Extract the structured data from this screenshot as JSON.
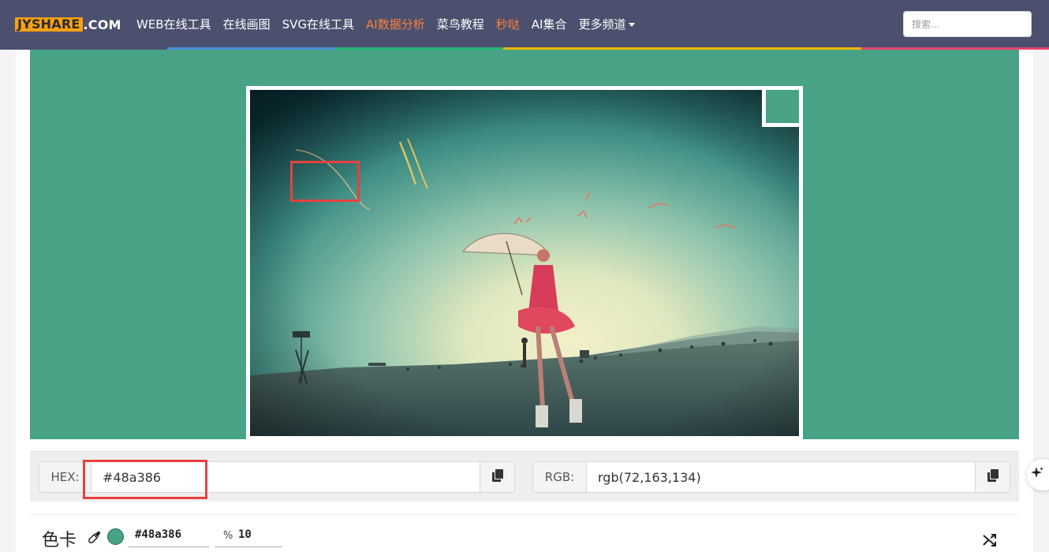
{
  "nav": {
    "logo_box": "JYSHARE",
    "logo_suffix": ".COM",
    "items": [
      {
        "label": "WEB在线工具",
        "highlight": false
      },
      {
        "label": "在线画图",
        "highlight": false
      },
      {
        "label": "SVG在线工具",
        "highlight": false
      },
      {
        "label": "AI数据分析",
        "highlight": true
      },
      {
        "label": "菜鸟教程",
        "highlight": false
      },
      {
        "label": "秒哒",
        "highlight": true
      },
      {
        "label": "AI集合",
        "highlight": false
      },
      {
        "label": "更多频道",
        "highlight": false,
        "dropdown": true
      }
    ],
    "search_placeholder": "搜索..."
  },
  "colors": {
    "navbar": "#4b506e",
    "picked": "#48a386",
    "accent_orange": "#ff7f3e",
    "highlight_red": "#e8413d",
    "stripe": [
      "#4a90d9",
      "#2bb673",
      "#f5b800",
      "#e8436b"
    ]
  },
  "picker": {
    "hex_label": "HEX:",
    "hex_value": "#48a386",
    "rgb_label": "RGB:",
    "rgb_value": "rgb(72,163,134)"
  },
  "color_card": {
    "title": "色卡",
    "hex_value": "#48a386",
    "step_value": "10",
    "percent_symbol": "%"
  },
  "icons": {
    "copy": "copy-icon",
    "eyedropper": "eyedropper-icon",
    "shuffle": "shuffle-icon",
    "sparkle": "sparkle-icon",
    "caret": "caret-down-icon"
  }
}
